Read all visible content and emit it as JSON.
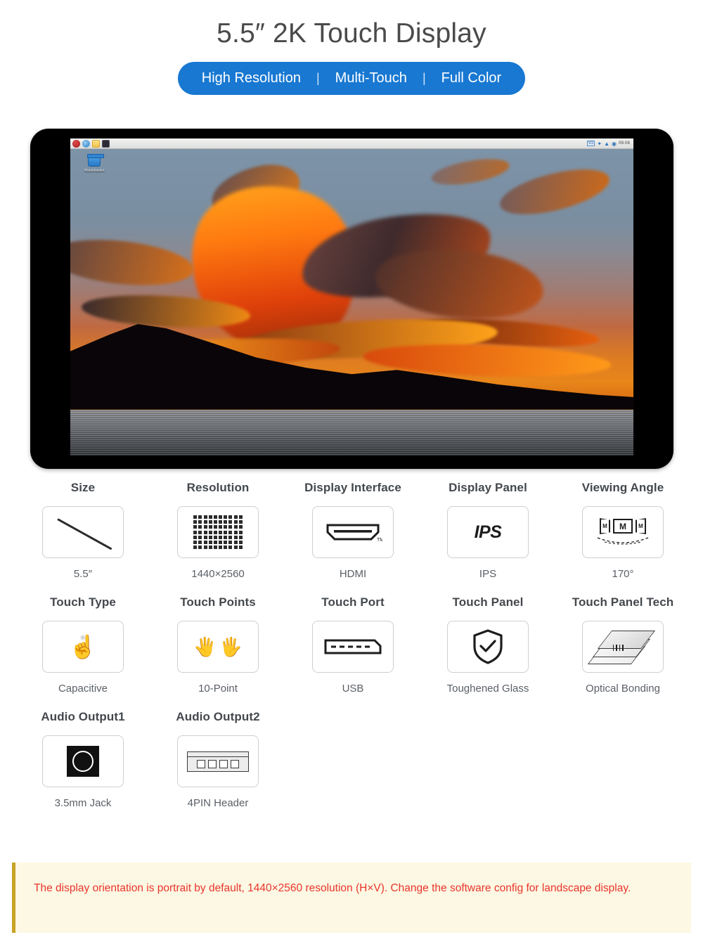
{
  "header": {
    "title": "5.5″ 2K Touch Display",
    "badge": {
      "items": [
        "High Resolution",
        "Multi-Touch",
        "Full Color"
      ],
      "separator": "|",
      "color": "#1878d2"
    }
  },
  "device_preview": {
    "taskbar": {
      "launchers": [
        "raspberry-menu",
        "web-browser",
        "file-manager",
        "terminal"
      ],
      "tray": [
        "cpu-monitor-v2",
        "bluetooth",
        "wifi",
        "volume"
      ],
      "tray_label": "V2",
      "clock": "09:08"
    },
    "desktop": {
      "icon_label": "Wastebasket"
    },
    "wallpaper": "sunset-clouds-over-mountain-lake"
  },
  "specs": [
    [
      {
        "title": "Size",
        "value": "5.5″",
        "icon": "diagonal-size-icon"
      },
      {
        "title": "Resolution",
        "value": "1440×2560",
        "icon": "pixel-grid-icon"
      },
      {
        "title": "Display Interface",
        "value": "HDMI",
        "icon": "hdmi-port-icon",
        "icon_mark": "TM"
      },
      {
        "title": "Display Panel",
        "value": "IPS",
        "icon": "ips-text-icon",
        "icon_text": "IPS"
      },
      {
        "title": "Viewing Angle",
        "value": "170°",
        "icon": "viewing-angle-icon",
        "icon_text": "M"
      }
    ],
    [
      {
        "title": "Touch Type",
        "value": "Capacitive",
        "icon": "pointing-hand-icon"
      },
      {
        "title": "Touch Points",
        "value": "10-Point",
        "icon": "two-hands-icon"
      },
      {
        "title": "Touch Port",
        "value": "USB",
        "icon": "usb-port-icon"
      },
      {
        "title": "Touch Panel",
        "value": "Toughened Glass",
        "icon": "shield-check-icon"
      },
      {
        "title": "Touch Panel Tech",
        "value": "Optical Bonding",
        "icon": "layer-stack-icon"
      }
    ],
    [
      {
        "title": "Audio Output1",
        "value": "3.5mm Jack",
        "icon": "audio-jack-icon"
      },
      {
        "title": "Audio Output2",
        "value": "4PIN Header",
        "icon": "pin-header-icon"
      },
      {
        "title": "",
        "value": "",
        "icon": ""
      },
      {
        "title": "",
        "value": "",
        "icon": ""
      },
      {
        "title": "",
        "value": "",
        "icon": ""
      }
    ]
  ],
  "note": {
    "text": "The display orientation is portrait by default, 1440×2560 resolution (H×V). Change the software config for landscape display.",
    "text_color": "#e8352c",
    "background": "#fdf8e3",
    "accent": "#c9a227"
  }
}
